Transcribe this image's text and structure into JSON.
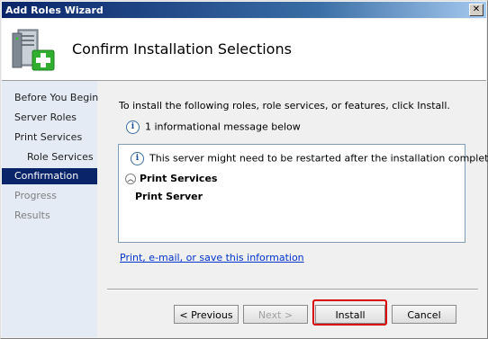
{
  "window": {
    "title": "Add Roles Wizard",
    "close_glyph": "✕"
  },
  "header": {
    "title": "Confirm Installation Selections",
    "icon": "server-add-icon"
  },
  "nav": {
    "items": [
      {
        "label": "Before You Begin",
        "state": "normal",
        "level": 0
      },
      {
        "label": "Server Roles",
        "state": "normal",
        "level": 0
      },
      {
        "label": "Print Services",
        "state": "normal",
        "level": 0
      },
      {
        "label": "Role Services",
        "state": "normal",
        "level": 1
      },
      {
        "label": "Confirmation",
        "state": "active",
        "level": 0
      },
      {
        "label": "Progress",
        "state": "disabled",
        "level": 0
      },
      {
        "label": "Results",
        "state": "disabled",
        "level": 0
      }
    ]
  },
  "main": {
    "intro": "To install the following roles, role services, or features, click Install.",
    "info_count": "1 informational message below",
    "results": {
      "message": "This server might need to be restarted after the installation completes.",
      "group_label": "Print Services",
      "item_label": "Print Server"
    },
    "link": "Print, e-mail, or save this information"
  },
  "buttons": {
    "previous": "< Previous",
    "next": "Next >",
    "install": "Install",
    "cancel": "Cancel"
  },
  "colors": {
    "titlebar": "#0a246a",
    "nav_active": "#0a246a",
    "highlight": "#d90000",
    "link": "#0033cc"
  }
}
